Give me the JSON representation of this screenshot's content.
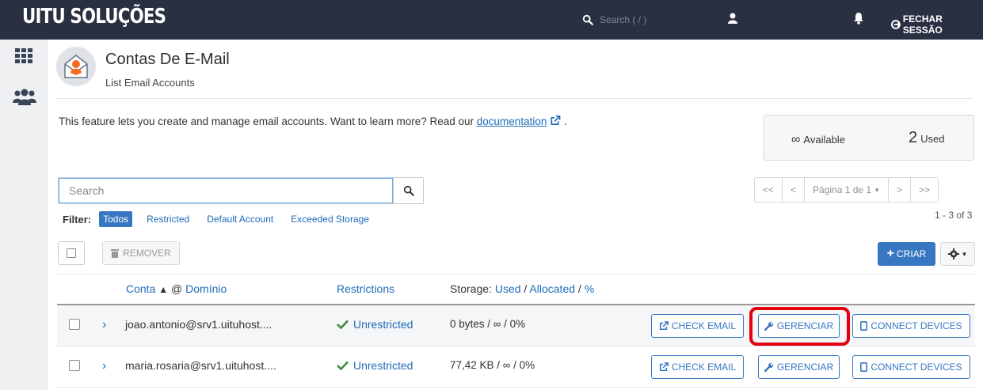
{
  "topbar": {
    "brand": "UITU SOLUÇÕES",
    "search_placeholder": "Search ( / )",
    "logout_label": "FECHAR SESSÃO"
  },
  "header": {
    "title": "Contas De E-Mail",
    "subtitle": "List Email Accounts"
  },
  "intro": {
    "text": "This feature lets you create and manage email accounts. Want to learn more? Read our ",
    "link": "documentation",
    "after": "."
  },
  "usage": {
    "available_symbol": "∞",
    "available_label": "Available",
    "used_count": "2",
    "used_label": "Used"
  },
  "search": {
    "placeholder": "Search"
  },
  "pager": {
    "first": "<<",
    "prev": "<",
    "page_label": "Página 1 de 1",
    "next": ">",
    "last": ">>",
    "range": "1 - 3 of 3"
  },
  "filter": {
    "label": "Filter:",
    "options": [
      "Todos",
      "Restricted",
      "Default Account",
      "Exceeded Storage"
    ],
    "active": "Todos"
  },
  "toolbar": {
    "remove_label": "REMOVER",
    "create_label": "CRIAR"
  },
  "table": {
    "col_account": "Conta",
    "col_domain": "Domínio",
    "col_restrictions": "Restrictions",
    "col_storage_prefix": "Storage:",
    "col_storage_used": "Used",
    "col_storage_allocated": "Allocated",
    "col_storage_pct": "%",
    "rows": [
      {
        "account": "joao.antonio@srv1.uituhost....",
        "restriction": "Unrestricted",
        "storage": "0 bytes / ∞ / 0%"
      },
      {
        "account": "maria.rosaria@srv1.uituhost....",
        "restriction": "Unrestricted",
        "storage": "77,42 KB / ∞ / 0%"
      }
    ],
    "btn_check": "CHECK EMAIL",
    "btn_manage": "GERENCIAR",
    "btn_connect": "CONNECT DEVICES"
  },
  "colors": {
    "topbar": "#283041",
    "accent": "#3777c1",
    "highlight": "#e3000f"
  }
}
